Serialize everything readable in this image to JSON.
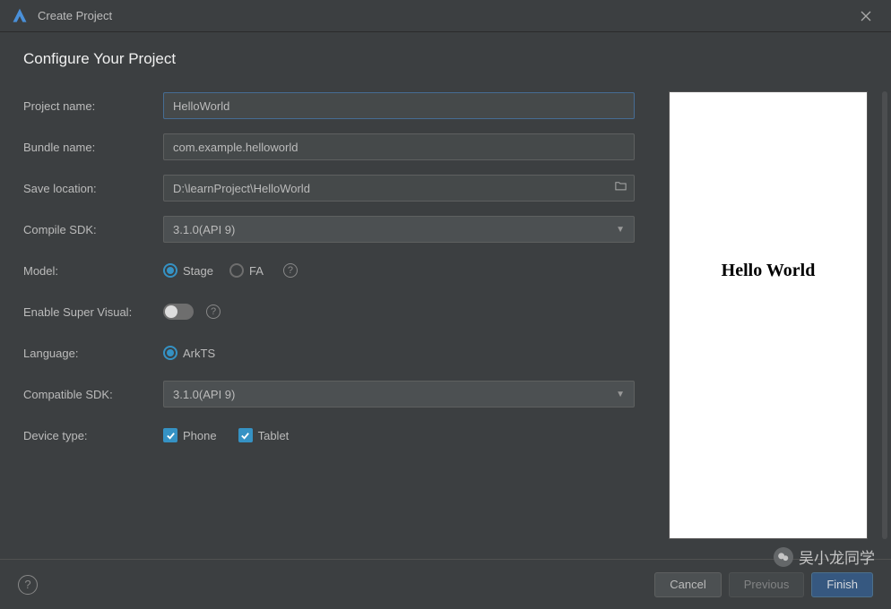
{
  "window": {
    "title": "Create Project"
  },
  "page": {
    "header": "Configure Your Project"
  },
  "form": {
    "project_name": {
      "label": "Project name:",
      "value": "HelloWorld"
    },
    "bundle_name": {
      "label": "Bundle name:",
      "value": "com.example.helloworld"
    },
    "save_location": {
      "label": "Save location:",
      "value": "D:\\learnProject\\HelloWorld"
    },
    "compile_sdk": {
      "label": "Compile SDK:",
      "selected": "3.1.0(API 9)"
    },
    "model": {
      "label": "Model:",
      "options": [
        "Stage",
        "FA"
      ],
      "selected": "Stage"
    },
    "enable_super_visual": {
      "label": "Enable Super Visual:",
      "enabled": false
    },
    "language": {
      "label": "Language:",
      "options": [
        "ArkTS"
      ],
      "selected": "ArkTS"
    },
    "compatible_sdk": {
      "label": "Compatible SDK:",
      "selected": "3.1.0(API 9)"
    },
    "device_type": {
      "label": "Device type:",
      "options": [
        {
          "label": "Phone",
          "checked": true
        },
        {
          "label": "Tablet",
          "checked": true
        }
      ]
    }
  },
  "preview": {
    "content": "Hello World"
  },
  "footer": {
    "cancel": "Cancel",
    "previous": "Previous",
    "finish": "Finish"
  },
  "watermark": {
    "text": "吴小龙同学"
  }
}
